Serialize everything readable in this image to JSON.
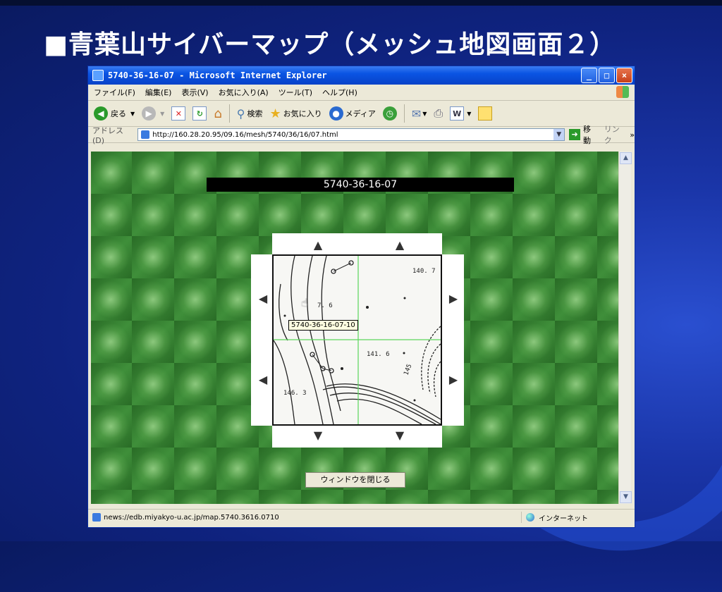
{
  "slide": {
    "title": "■青葉山サイバーマップ（メッシュ地図画面２）"
  },
  "window": {
    "title": "5740-36-16-07 - Microsoft Internet Explorer",
    "controls": [
      "_",
      "□",
      "×"
    ]
  },
  "menu": {
    "items": [
      "ファイル(F)",
      "編集(E)",
      "表示(V)",
      "お気に入り(A)",
      "ツール(T)",
      "ヘルプ(H)"
    ]
  },
  "toolbar": {
    "back_label": "戻る",
    "search_label": "検索",
    "favorites_label": "お気に入り",
    "media_label": "メディア"
  },
  "address": {
    "label": "アドレス(D)",
    "url": "http://160.28.20.95/09.16/mesh/5740/36/16/07.html",
    "go_label": "移動",
    "links_label": "リンク"
  },
  "page": {
    "mesh_title": "5740-36-16-07",
    "tooltip": "5740-36-16-07-10",
    "close_button": "ウィンドウを閉じる",
    "map_labels": {
      "elev_1": "140. 7",
      "elev_2": "141. 6",
      "elev_3": "7. 6",
      "elev_4": "146. 3",
      "contour_1": "145"
    }
  },
  "status": {
    "url": "news://edb.miyakyo-u.ac.jp/map.5740.3616.0710",
    "zone": "インターネット"
  },
  "colors": {
    "background": "#0f2380",
    "titlebar": "#0a54e3",
    "grid_green": "#3f8f3a",
    "map_grid": "#5bd65b"
  }
}
